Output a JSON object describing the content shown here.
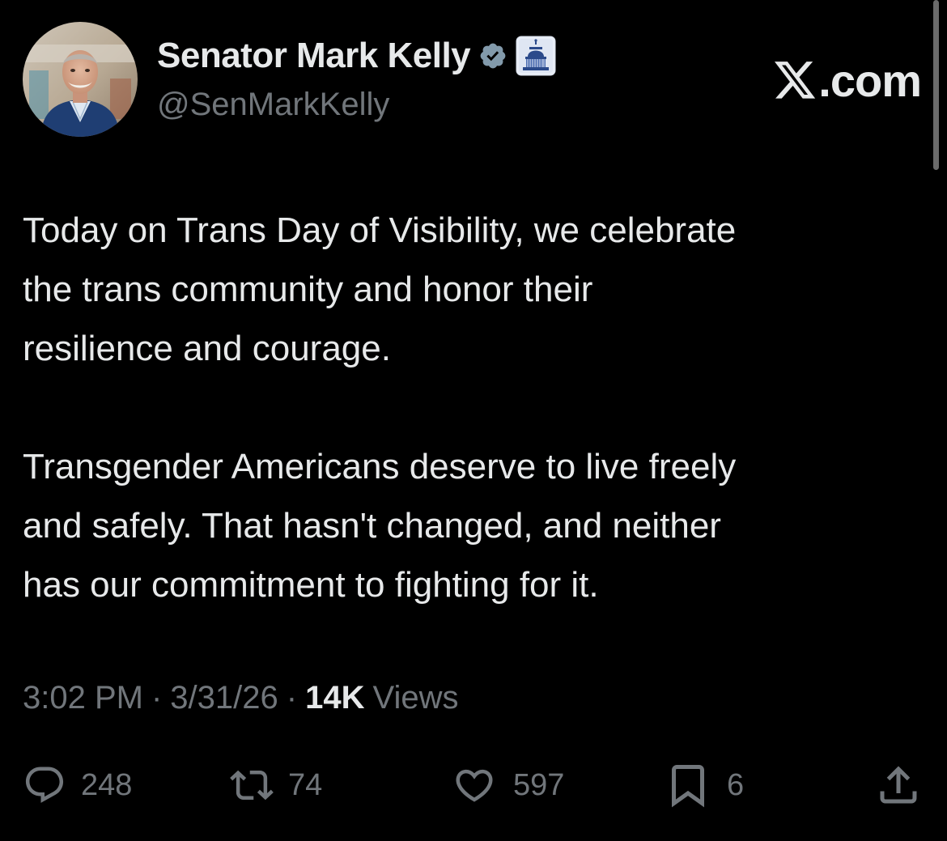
{
  "author": {
    "display_name": "Senator Mark Kelly",
    "handle": "@SenMarkKelly",
    "avatar_icon": "profile-photo",
    "verified_icon": "verified-badge-icon",
    "affiliation_icon": "capitol-dome-icon"
  },
  "brand": {
    "logo_text": ".com",
    "logo_icon": "x-logo-icon"
  },
  "tweet": {
    "paragraph_1": "Today on Trans Day of Visibility, we celebrate\nthe trans community and honor their\nresilience and courage.",
    "paragraph_2": "Transgender Americans deserve to live freely\nand safely. That hasn't changed, and neither\nhas our commitment to fighting for it."
  },
  "meta": {
    "time": "3:02 PM",
    "date": "3/31/26",
    "separator": "·",
    "views_count": "14K",
    "views_label": "Views"
  },
  "actions": {
    "replies": "248",
    "reposts": "74",
    "likes": "597",
    "bookmarks": "6"
  },
  "colors": {
    "background": "#000000",
    "primary_text": "#e7e9ea",
    "secondary_text": "#71767b",
    "verified_badge": "#829aab"
  }
}
